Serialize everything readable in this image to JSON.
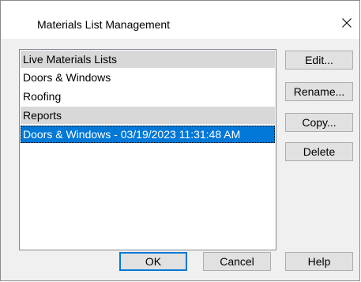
{
  "window": {
    "title": "Materials List Management",
    "close_icon": "close-icon"
  },
  "list": {
    "rows": [
      {
        "label": "Live Materials Lists",
        "kind": "group"
      },
      {
        "label": "Doors & Windows",
        "kind": "item"
      },
      {
        "label": "Roofing",
        "kind": "item"
      },
      {
        "label": "Reports",
        "kind": "group"
      },
      {
        "label": "Doors & Windows - 03/19/2023 11:31:48 AM",
        "kind": "item",
        "selected": true
      }
    ]
  },
  "side_buttons": {
    "edit": "Edit...",
    "rename": "Rename...",
    "copy": "Copy...",
    "delete": "Delete"
  },
  "bottom_buttons": {
    "ok": "OK",
    "cancel": "Cancel",
    "help": "Help"
  },
  "colors": {
    "selection": "#0078d7",
    "group_header": "#d8d8d8",
    "dialog_bg": "#f0f0f0"
  }
}
